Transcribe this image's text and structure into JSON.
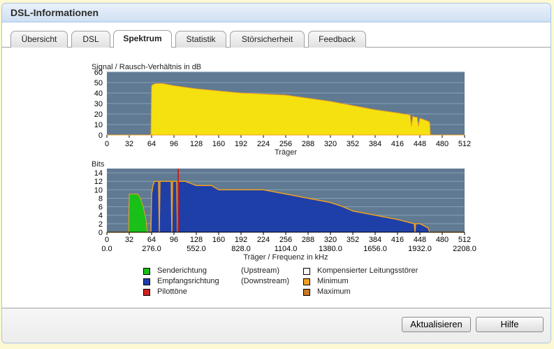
{
  "window": {
    "title": "DSL-Informationen"
  },
  "tabs": [
    {
      "label": "Übersicht",
      "active": false
    },
    {
      "label": "DSL",
      "active": false
    },
    {
      "label": "Spektrum",
      "active": true
    },
    {
      "label": "Statistik",
      "active": false
    },
    {
      "label": "Störsicherheit",
      "active": false
    },
    {
      "label": "Feedback",
      "active": false
    }
  ],
  "snr_chart": {
    "ylabel": "Signal / Rausch-Verhältnis in dB",
    "xlabel": "Träger",
    "y_ticks": [
      "60",
      "50",
      "40",
      "30",
      "20",
      "10",
      "0"
    ],
    "x_ticks": [
      "0",
      "32",
      "64",
      "96",
      "128",
      "160",
      "192",
      "224",
      "256",
      "288",
      "320",
      "352",
      "384",
      "416",
      "448",
      "480",
      "512"
    ]
  },
  "bits_chart": {
    "ylabel": "Bits",
    "xlabel": "Träger / Frequenz in kHz",
    "y_ticks": [
      "14",
      "12",
      "10",
      "8",
      "6",
      "4",
      "2",
      "0"
    ],
    "x_ticks": [
      "0",
      "32",
      "64",
      "96",
      "128",
      "160",
      "192",
      "224",
      "256",
      "288",
      "320",
      "352",
      "384",
      "416",
      "448",
      "480",
      "512"
    ],
    "freq_ticks": [
      "0.0",
      "276.0",
      "552.0",
      "828.0",
      "1104.0",
      "1380.0",
      "1656.0",
      "1932.0",
      "2208.0"
    ]
  },
  "legend": {
    "upstream_label": "Senderichtung",
    "upstream_note": "(Upstream)",
    "downstream_label": "Empfangsrichtung",
    "downstream_note": "(Downstream)",
    "pilot_label": "Pilottöne",
    "compensated_label": "Kompensierter Leitungsstörer",
    "minimum_label": "Minimum",
    "maximum_label": "Maximum"
  },
  "colors": {
    "plot_bg": "#5f7a92",
    "snr_fill": "#f5e10f",
    "upstream": "#18c018",
    "downstream": "#1f3fa8",
    "pilot": "#d02020",
    "minimum": "#f0a020",
    "maximum": "#c87820"
  },
  "buttons": {
    "refresh": "Aktualisieren",
    "help": "Hilfe"
  },
  "chart_data": [
    {
      "type": "area",
      "title": "Signal / Rausch-Verhältnis in dB",
      "xlabel": "Träger",
      "ylabel": "Signal / Rausch-Verhältnis in dB",
      "xlim": [
        0,
        512
      ],
      "ylim": [
        0,
        60
      ],
      "series": [
        {
          "x": [
            0,
            63,
            64,
            66,
            70,
            80,
            96,
            128,
            160,
            192,
            224,
            256,
            288,
            320,
            352,
            384,
            416,
            434,
            436,
            438,
            440,
            444,
            446,
            448,
            460,
            462,
            463,
            512
          ],
          "values": [
            0,
            0,
            47,
            48,
            49,
            49,
            47,
            44,
            42,
            40,
            39,
            38,
            35,
            32,
            28,
            24,
            21,
            19,
            8,
            18,
            17,
            17,
            8,
            16,
            13,
            12,
            0,
            0
          ]
        }
      ]
    },
    {
      "type": "area",
      "title": "Bits",
      "xlabel": "Träger / Frequenz in kHz",
      "ylabel": "Bits",
      "xlim": [
        0,
        512
      ],
      "ylim": [
        0,
        15
      ],
      "series": [
        {
          "name": "Senderichtung",
          "x": [
            0,
            31,
            32,
            44,
            48,
            52,
            56,
            57,
            58
          ],
          "values": [
            0,
            0,
            9,
            9,
            8,
            6,
            3,
            1,
            0
          ]
        },
        {
          "name": "Empfangsrichtung",
          "x": [
            0,
            63,
            64,
            66,
            68,
            70,
            72,
            74,
            75,
            76,
            78,
            80,
            88,
            92,
            93,
            94,
            96,
            100,
            101,
            102,
            112,
            128,
            150,
            160,
            192,
            224,
            256,
            288,
            320,
            338,
            352,
            384,
            416,
            440,
            441,
            442,
            448,
            460,
            462,
            464,
            512
          ],
          "values": [
            0,
            0,
            9,
            11,
            12,
            12,
            12,
            12,
            0,
            12,
            12,
            12,
            12,
            12,
            0,
            12,
            12,
            12,
            0,
            12,
            12,
            11,
            11,
            10,
            10,
            10,
            9,
            8,
            7,
            6,
            5,
            4,
            3,
            2,
            0,
            2,
            2,
            1,
            0,
            0,
            0
          ]
        },
        {
          "name": "Pilottöne",
          "x": [
            102
          ],
          "values": [
            15
          ]
        }
      ]
    }
  ]
}
